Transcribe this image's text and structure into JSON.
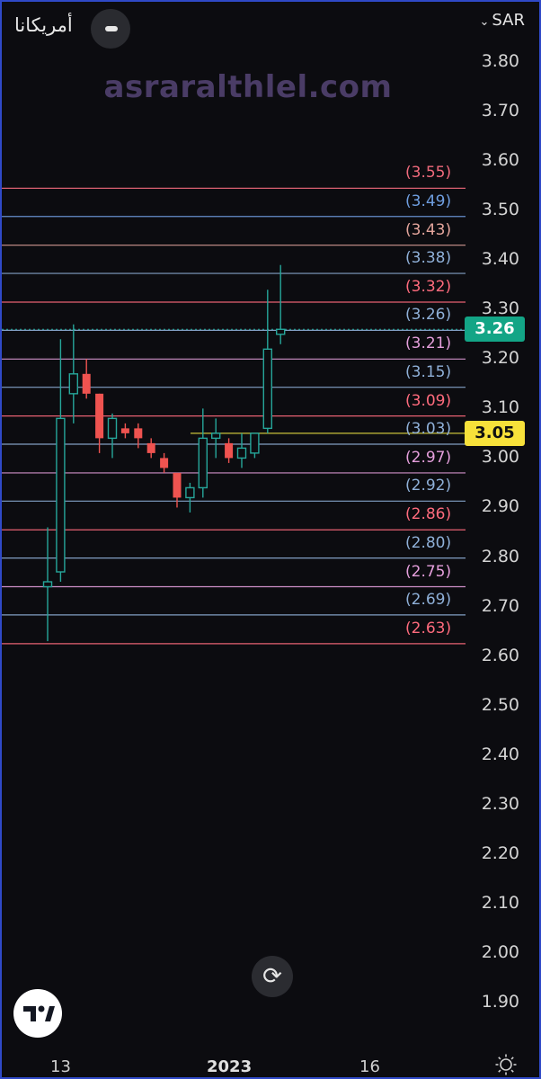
{
  "header": {
    "symbol_name": "أمريكانا",
    "currency": "SAR",
    "watermark": "asraralthlel.com"
  },
  "icons": {
    "collapse": "minus-icon",
    "currency_chevron": "chevron-down-icon",
    "logo": "tradingview-logo-icon",
    "reset": "reset-chart-icon",
    "settings": "sun-settings-icon"
  },
  "colors": {
    "background": "#0c0c10",
    "up_candle": "#26a69a",
    "down_candle": "#ef5350",
    "frame_border": "#2f49c7",
    "last_price_bg": "#13a586",
    "highlight_price_bg": "#f7e13a"
  },
  "price_tags": {
    "last": "3.26",
    "highlight": "3.05"
  },
  "chart_data": {
    "type": "candlestick",
    "y_axis": {
      "ticks": [
        "3.80",
        "3.70",
        "3.60",
        "3.50",
        "3.40",
        "3.30",
        "3.20",
        "3.10",
        "3.00",
        "2.90",
        "2.80",
        "2.70",
        "2.60",
        "2.50",
        "2.40",
        "2.30",
        "2.20",
        "2.10",
        "2.00",
        "1.90"
      ],
      "range": [
        1.85,
        3.85
      ]
    },
    "x_axis": {
      "ticks": [
        "13",
        "2023",
        "16"
      ]
    },
    "levels": [
      {
        "label": "(3.55)",
        "value": 3.545,
        "color": "#f06a7c"
      },
      {
        "label": "(3.49)",
        "value": 3.488,
        "color": "#6f9ee0"
      },
      {
        "label": "(3.43)",
        "value": 3.43,
        "color": "#e4a59c"
      },
      {
        "label": "(3.38)",
        "value": 3.373,
        "color": "#8fb0d8"
      },
      {
        "label": "(3.32)",
        "value": 3.315,
        "color": "#ff6b7d"
      },
      {
        "label": "(3.26)",
        "value": 3.258,
        "color": "#8fb0d8"
      },
      {
        "label": "(3.21)",
        "value": 3.2,
        "color": "#e59fdc"
      },
      {
        "label": "(3.15)",
        "value": 3.143,
        "color": "#8fb0d8"
      },
      {
        "label": "(3.09)",
        "value": 3.085,
        "color": "#ff6b7d"
      },
      {
        "label": "(3.03)",
        "value": 3.028,
        "color": "#8fb0d8"
      },
      {
        "label": "(2.97)",
        "value": 2.97,
        "color": "#e59fdc"
      },
      {
        "label": "(2.92)",
        "value": 2.913,
        "color": "#8fb0d8"
      },
      {
        "label": "(2.86)",
        "value": 2.855,
        "color": "#ff6b7d"
      },
      {
        "label": "(2.80)",
        "value": 2.798,
        "color": "#8fb0d8"
      },
      {
        "label": "(2.75)",
        "value": 2.74,
        "color": "#e59fdc"
      },
      {
        "label": "(2.69)",
        "value": 2.683,
        "color": "#8fb0d8"
      },
      {
        "label": "(2.63)",
        "value": 2.625,
        "color": "#ff6b7d"
      }
    ],
    "candles": [
      {
        "o": 2.74,
        "h": 2.86,
        "l": 2.63,
        "c": 2.75
      },
      {
        "o": 2.77,
        "h": 3.24,
        "l": 2.75,
        "c": 3.08
      },
      {
        "o": 3.13,
        "h": 3.27,
        "l": 3.07,
        "c": 3.17
      },
      {
        "o": 3.17,
        "h": 3.2,
        "l": 3.12,
        "c": 3.13
      },
      {
        "o": 3.13,
        "h": 3.13,
        "l": 3.01,
        "c": 3.04
      },
      {
        "o": 3.04,
        "h": 3.09,
        "l": 3.0,
        "c": 3.08
      },
      {
        "o": 3.06,
        "h": 3.07,
        "l": 3.04,
        "c": 3.05
      },
      {
        "o": 3.06,
        "h": 3.07,
        "l": 3.02,
        "c": 3.04
      },
      {
        "o": 3.03,
        "h": 3.04,
        "l": 3.0,
        "c": 3.01
      },
      {
        "o": 3.0,
        "h": 3.01,
        "l": 2.97,
        "c": 2.98
      },
      {
        "o": 2.97,
        "h": 2.97,
        "l": 2.9,
        "c": 2.92
      },
      {
        "o": 2.92,
        "h": 2.95,
        "l": 2.89,
        "c": 2.94
      },
      {
        "o": 2.94,
        "h": 3.1,
        "l": 2.92,
        "c": 3.04
      },
      {
        "o": 3.04,
        "h": 3.08,
        "l": 3.0,
        "c": 3.05
      },
      {
        "o": 3.03,
        "h": 3.04,
        "l": 2.99,
        "c": 3.0
      },
      {
        "o": 3.0,
        "h": 3.05,
        "l": 2.98,
        "c": 3.02
      },
      {
        "o": 3.01,
        "h": 3.05,
        "l": 3.0,
        "c": 3.05
      },
      {
        "o": 3.06,
        "h": 3.34,
        "l": 3.05,
        "c": 3.22
      },
      {
        "o": 3.25,
        "h": 3.39,
        "l": 3.23,
        "c": 3.26
      }
    ],
    "annotations": [
      {
        "label": "3.05",
        "value": 3.05
      }
    ]
  }
}
